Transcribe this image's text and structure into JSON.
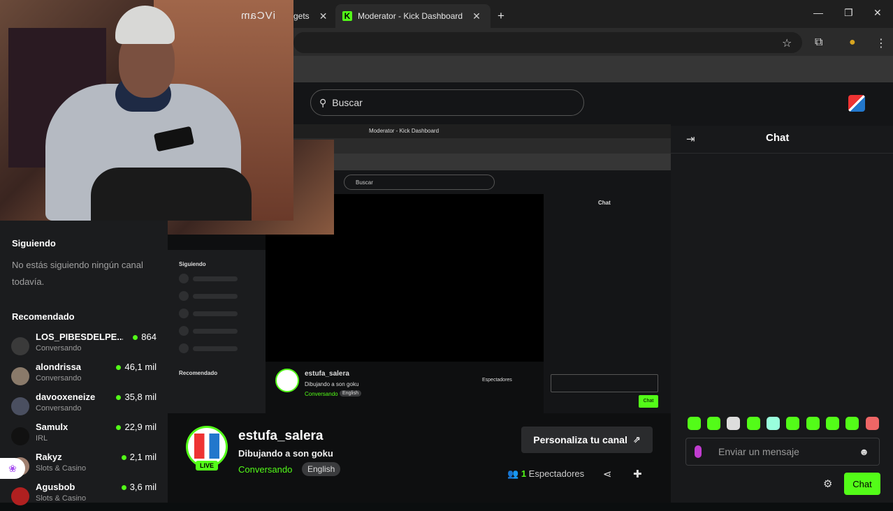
{
  "browser": {
    "tab_partial": "gets",
    "tab_active": "Moderator - Kick Dashboard",
    "new_tab": "+"
  },
  "header": {
    "search_placeholder": "Buscar"
  },
  "sidebar": {
    "following_title": "Siguiendo",
    "following_empty": "No estás siguiendo ningún canal todavía.",
    "recommended_title": "Recomendado",
    "items": [
      {
        "name": "LOS_PIBESDELPE...",
        "category": "Conversando",
        "viewers": "864"
      },
      {
        "name": "alondrissa",
        "category": "Conversando",
        "viewers": "46,1 mil"
      },
      {
        "name": "davooxeneize",
        "category": "Conversando",
        "viewers": "35,8 mil"
      },
      {
        "name": "Samulx",
        "category": "IRL",
        "viewers": "22,9 mil"
      },
      {
        "name": "Rakyz",
        "category": "Slots & Casino",
        "viewers": "2,1 mil"
      },
      {
        "name": "Agusbob",
        "category": "Slots & Casino",
        "viewers": "3,6 mil"
      }
    ]
  },
  "webcam": {
    "overlay_text": "iVCam"
  },
  "nested": {
    "tab": "Moderator - Kick Dashboard",
    "search": "Buscar",
    "chat": "Chat",
    "following": "Siguiendo",
    "recommended": "Recomendado",
    "streamer": "estufa_salera",
    "title": "Dibujando a son goku",
    "category": "Conversando",
    "lang": "English",
    "viewers": "Espectadores",
    "chat_btn": "Chat"
  },
  "stream": {
    "live_badge": "LIVE",
    "streamer": "estufa_salera",
    "title": "Dibujando a son goku",
    "category": "Conversando",
    "language": "English",
    "customize_label": "Personaliza tu canal",
    "viewer_count": "1",
    "viewer_label": "Espectadores"
  },
  "chat": {
    "title": "Chat",
    "placeholder": "Enviar un mensaje",
    "send_label": "Chat"
  },
  "colors": {
    "accent": "#53fc18",
    "bg": "#0b0e0f",
    "panel": "#18191b"
  }
}
